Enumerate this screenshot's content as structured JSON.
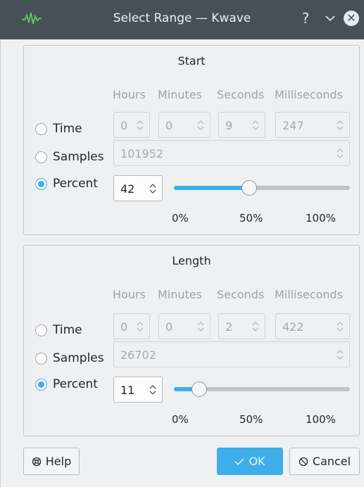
{
  "window": {
    "title": "Select Range — Kwave",
    "help_glyph": "?",
    "minimize_glyph": "⌄",
    "close_glyph": "✕",
    "icon": "waveform-icon"
  },
  "start": {
    "title": "Start",
    "columns": [
      "Hours",
      "Minutes",
      "Seconds",
      "Milliseconds"
    ],
    "time_label": "Time",
    "samples_label": "Samples",
    "percent_label": "Percent",
    "time": {
      "hours": "0",
      "minutes": "0",
      "seconds": "9",
      "milliseconds": "247"
    },
    "samples": "101952",
    "percent": "42",
    "slider_value": 0.42,
    "selected": "percent",
    "ticks": [
      "0%",
      "50%",
      "100%"
    ]
  },
  "length": {
    "title": "Length",
    "columns": [
      "Hours",
      "Minutes",
      "Seconds",
      "Milliseconds"
    ],
    "time_label": "Time",
    "samples_label": "Samples",
    "percent_label": "Percent",
    "time": {
      "hours": "0",
      "minutes": "0",
      "seconds": "2",
      "milliseconds": "422"
    },
    "samples": "26702",
    "percent": "11",
    "slider_value": 0.11,
    "selected": "percent",
    "ticks": [
      "0%",
      "50%",
      "100%"
    ]
  },
  "buttons": {
    "help": "Help",
    "ok": "OK",
    "cancel": "Cancel"
  },
  "colors": {
    "accent": "#3daee9",
    "titlebar": "#475057"
  }
}
